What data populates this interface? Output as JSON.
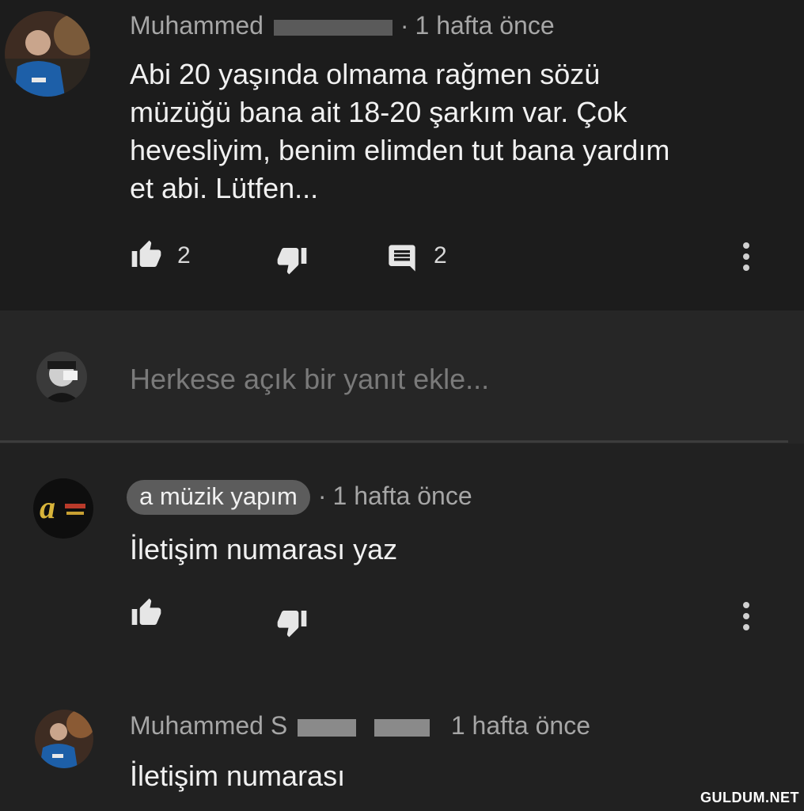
{
  "comment1": {
    "author_visible": "Muhammed",
    "time": "1 hafta önce",
    "text_lines": [
      "Abi 20 yaşında olmama rağmen sözü",
      "müzüğü bana ait 18-20 şarkım var. Çok",
      "hevesliyim, benim elimden tut bana yardım",
      "et abi. Lütfen..."
    ],
    "like_count": "2",
    "reply_count": "2"
  },
  "reply_box": {
    "placeholder": "Herkese açık bir yanıt ekle..."
  },
  "reply1": {
    "author": "a müzik yapım",
    "time": "1 hafta önce",
    "text": "İletişim numarası yaz"
  },
  "reply2": {
    "author_visible": "Muhammed S",
    "time": "1 hafta önce",
    "text": "İletişim numarası"
  },
  "watermark": "GULDUM.NET",
  "icons": [
    "thumbs-up-icon",
    "thumbs-down-icon",
    "comment-icon",
    "more-vert-icon"
  ],
  "colors": {
    "background": "#212121",
    "text": "#f1f1f1",
    "meta_text": "#a6a6a6",
    "chip": "#5c5c5c"
  }
}
